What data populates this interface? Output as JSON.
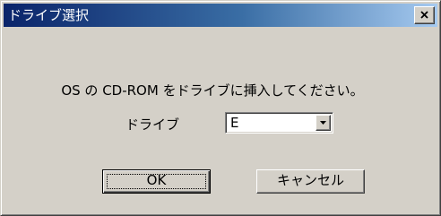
{
  "window": {
    "title": "ドライブ選択",
    "close_icon": "close-icon"
  },
  "message": "OS の CD-ROM をドライブに挿入してください。",
  "drive": {
    "label": "ドライブ",
    "selected": "E",
    "dropdown_icon": "chevron-down-icon"
  },
  "buttons": {
    "ok": "OK",
    "cancel": "キャンセル"
  },
  "colors": {
    "face": "#d4d0c8",
    "title_start": "#0a246a",
    "title_end": "#a6caf0"
  }
}
